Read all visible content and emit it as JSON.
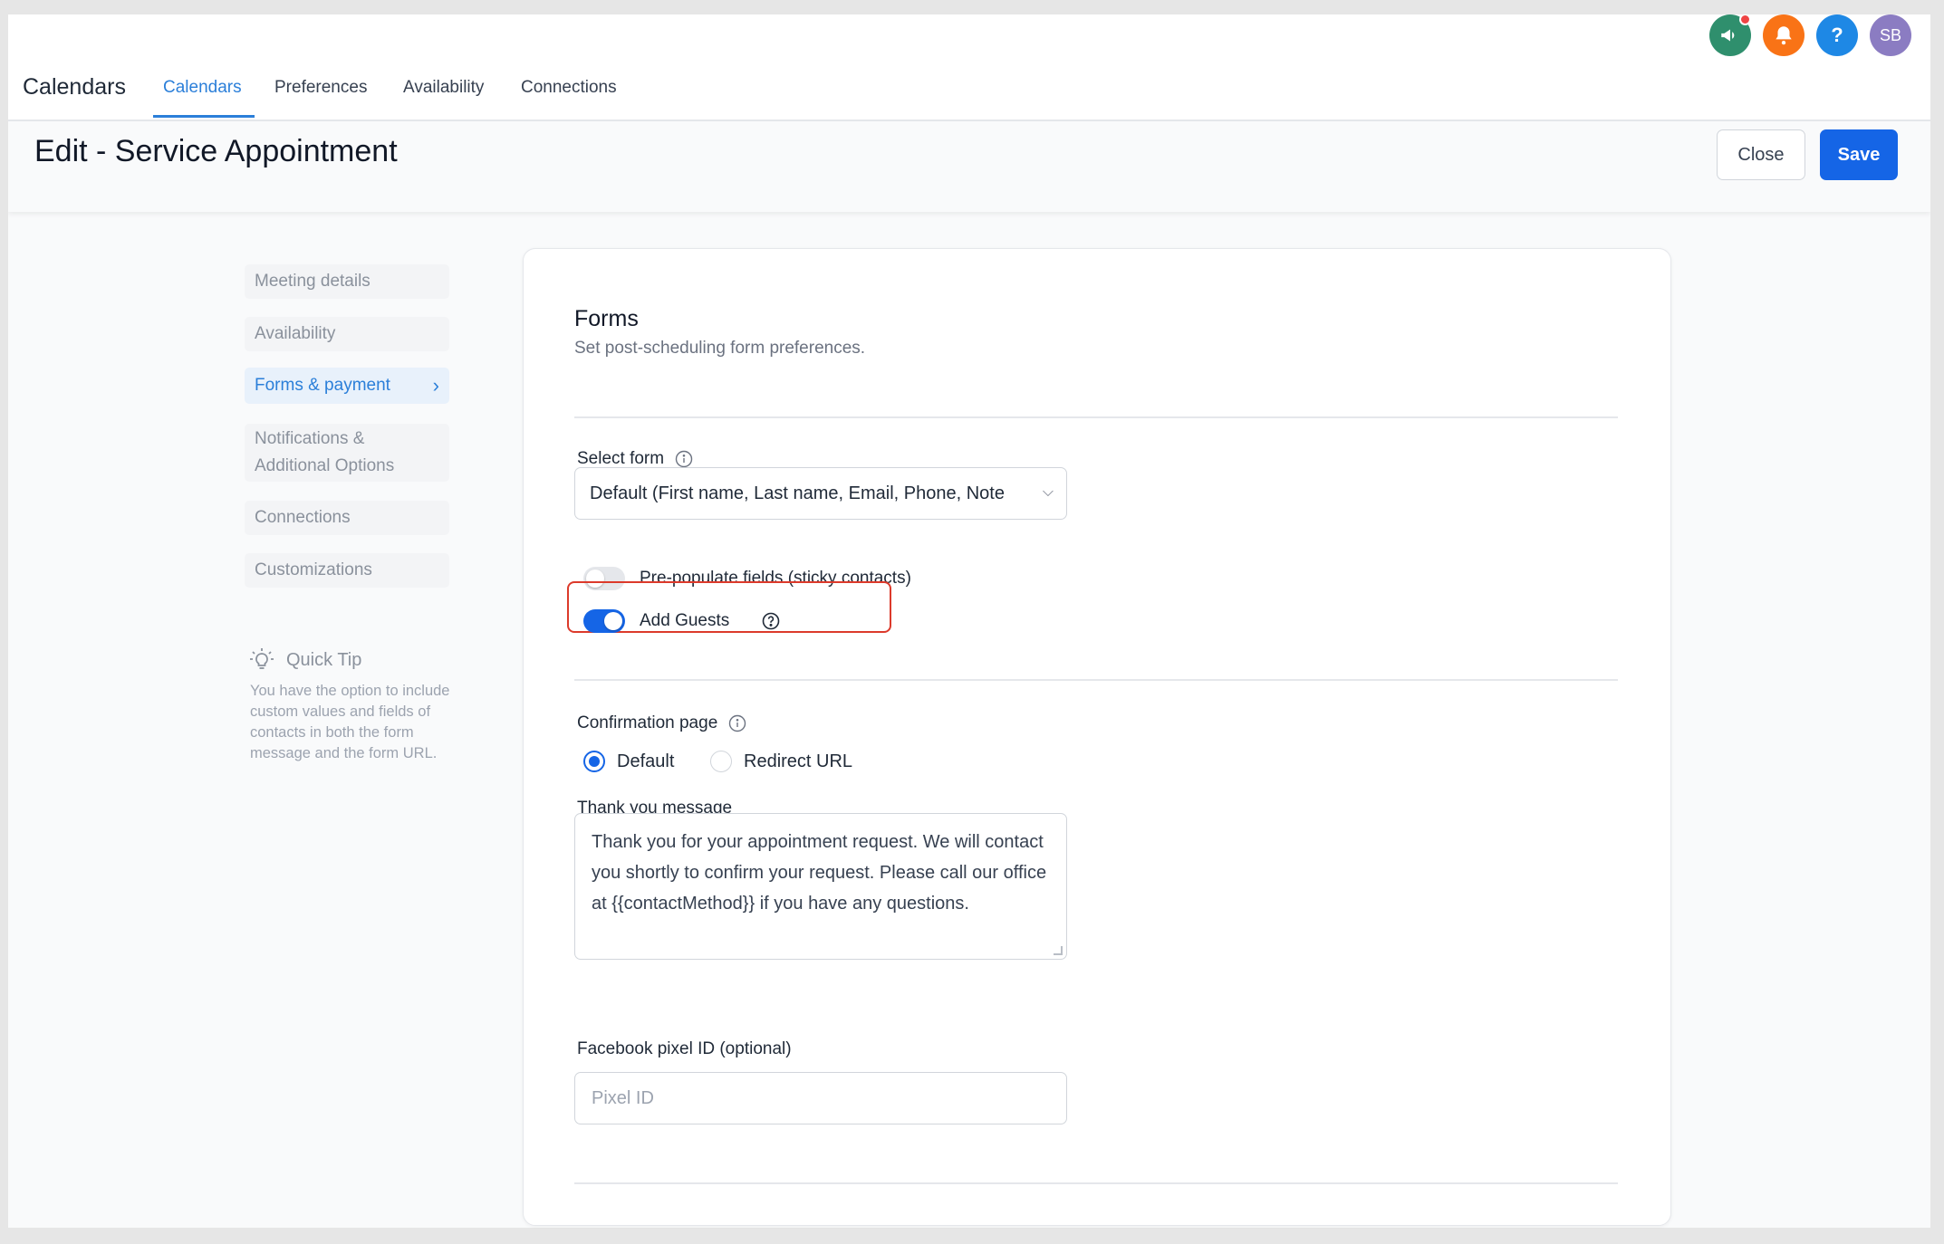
{
  "topnav": {
    "brand": "Calendars",
    "tabs": [
      {
        "label": "Calendars",
        "active": true
      },
      {
        "label": "Preferences",
        "active": false
      },
      {
        "label": "Availability",
        "active": false
      },
      {
        "label": "Connections",
        "active": false
      }
    ],
    "actions": {
      "announcement_icon": "megaphone-icon",
      "notification_icon": "bell-icon",
      "help_label": "?",
      "avatar_initials": "SB"
    },
    "colors": {
      "accent": "#2b7fd9",
      "announce": "#2f8f6d",
      "bell": "#f97316",
      "help": "#1e88e5",
      "avatar": "#8b7cc2"
    }
  },
  "header": {
    "title": "Edit - Service Appointment",
    "close_label": "Close",
    "save_label": "Save"
  },
  "sidenav": {
    "items": [
      {
        "label": "Meeting details"
      },
      {
        "label": "Availability"
      },
      {
        "label": "Forms & payment"
      },
      {
        "label": "Notifications & Additional Options"
      },
      {
        "label": "Connections"
      },
      {
        "label": "Customizations"
      }
    ],
    "active_chevron": "›",
    "tip": {
      "title": "Quick Tip",
      "text": "You have the option to include custom values and fields of contacts in both the form message and the form URL."
    }
  },
  "forms": {
    "title": "Forms",
    "subtitle": "Set post-scheduling form preferences.",
    "select_form_label": "Select form",
    "select_form_value": "Default (First name, Last name, Email, Phone, Note",
    "prepopulate_label": "Pre-populate fields (sticky contacts)",
    "prepopulate_on": false,
    "add_guests_label": "Add Guests",
    "add_guests_on": true,
    "confirmation_label": "Confirmation page",
    "confirmation_options": [
      "Default",
      "Redirect URL"
    ],
    "confirmation_selected": "Default",
    "thank_you_label": "Thank you message",
    "thank_you_text": "Thank you for your appointment request. We will contact you shortly to confirm your request. Please call our office at {{contactMethod}} if you have any questions.",
    "pixel_label": "Facebook pixel ID (optional)",
    "pixel_placeholder": "Pixel ID"
  }
}
